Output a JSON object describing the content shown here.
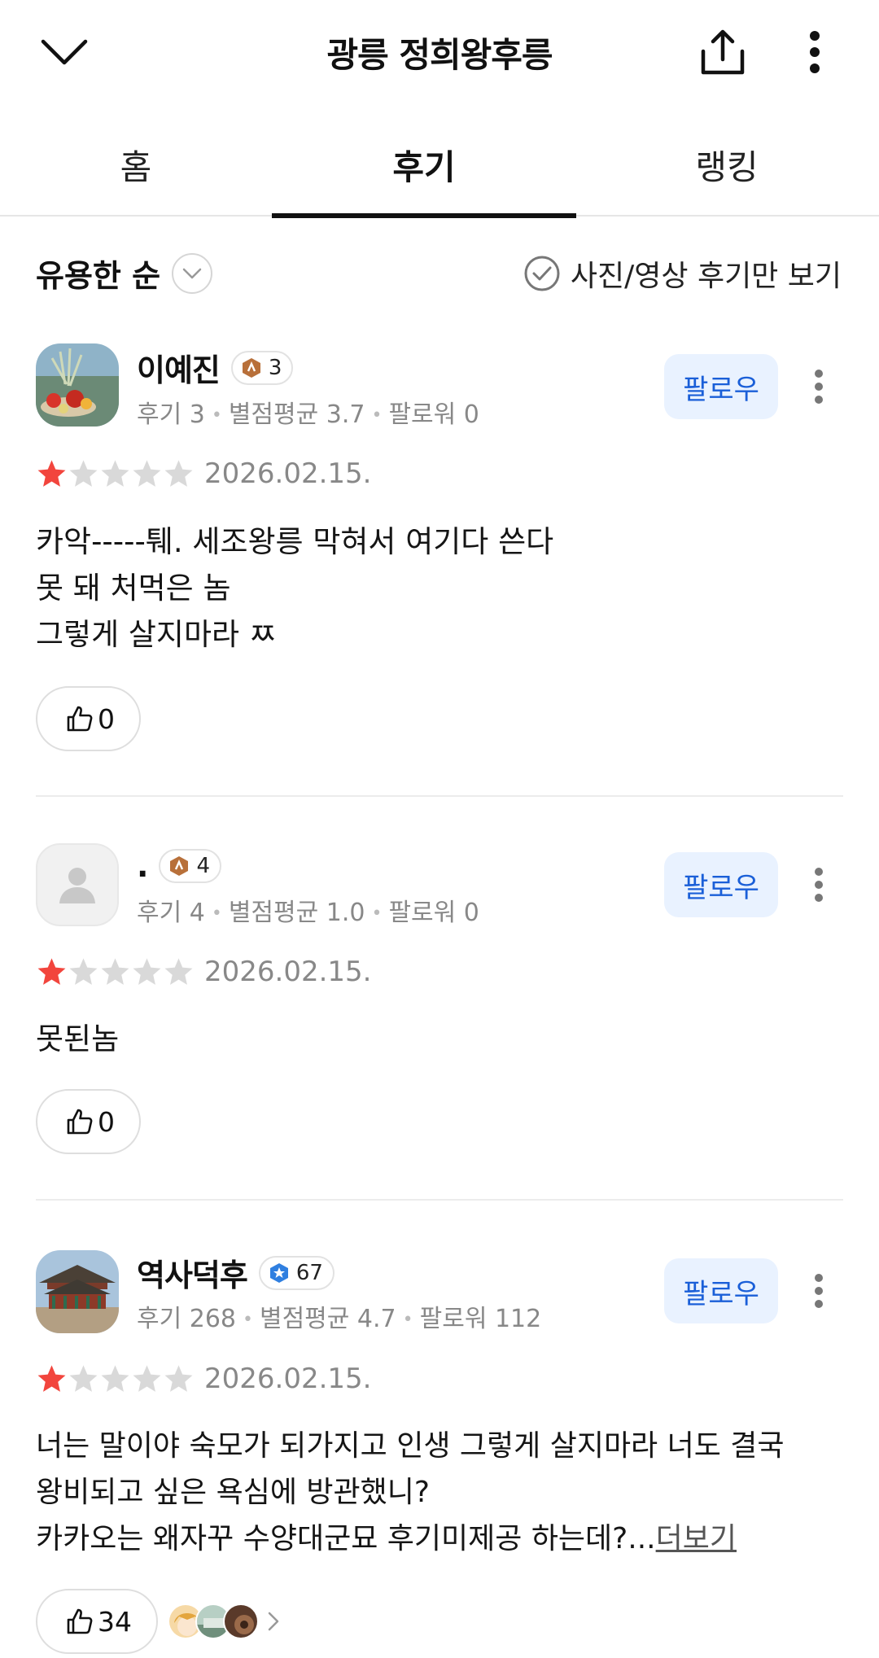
{
  "header": {
    "title": "광릉 정희왕후릉",
    "back_icon": "chevron-down-icon",
    "share_icon": "share-icon",
    "more_icon": "more-vertical-icon"
  },
  "tabs": [
    {
      "label": "홈",
      "active": false
    },
    {
      "label": "후기",
      "active": true
    },
    {
      "label": "랭킹",
      "active": false
    }
  ],
  "filter": {
    "sort_label": "유용한 순",
    "photo_only_label": "사진/영상 후기만 보기"
  },
  "reviews": [
    {
      "name": "이예진",
      "badge": "3",
      "stats": {
        "reviews": "후기 3",
        "avg": "별점평균 3.7",
        "followers": "팔로워 0"
      },
      "follow_label": "팔로우",
      "stars": 1,
      "date": "2026.02.15.",
      "body_lines": [
        "카악-----퉤. 세조왕릉 막혀서 여기다 쓴다",
        "못 돼 처먹은 놈",
        "그렇게 살지마라 ㅉ"
      ],
      "likes": "0"
    },
    {
      "name": ".",
      "badge": "4",
      "stats": {
        "reviews": "후기 4",
        "avg": "별점평균 1.0",
        "followers": "팔로워 0"
      },
      "follow_label": "팔로우",
      "stars": 1,
      "date": "2026.02.15.",
      "body_lines": [
        "못된놈"
      ],
      "likes": "0"
    },
    {
      "name": "역사덕후",
      "badge": "67",
      "stats": {
        "reviews": "후기 268",
        "avg": "별점평균 4.7",
        "followers": "팔로워 112"
      },
      "follow_label": "팔로우",
      "stars": 1,
      "date": "2026.02.15.",
      "body_lines": [
        "너는 말이야 숙모가 되가지고 인생 그렇게 살지마라 너도 결국",
        "왕비되고 싶은 욕심에 방관했니?",
        "카카오는 왜자꾸 수양대군묘 후기미제공 하는데?..."
      ],
      "more_label": "더보기",
      "likes": "34"
    }
  ],
  "colors": {
    "accent_blue": "#1a5fd8",
    "follow_bg": "#e9f2ff",
    "star_on": "#f2453d",
    "star_off": "#d9d9d9",
    "badge_bronze": "#b8703a",
    "badge_blue": "#2f7fe0"
  }
}
